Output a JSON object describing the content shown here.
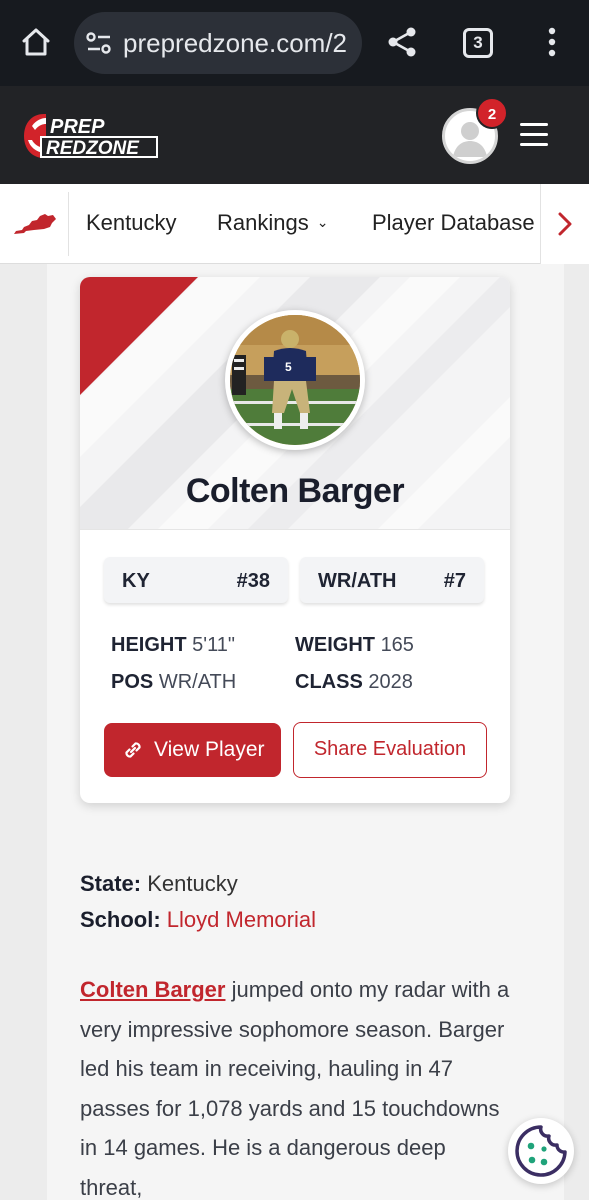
{
  "browser": {
    "url": "prepredzone.com/2",
    "tab_count": "3",
    "icons": [
      "home-icon",
      "site-settings-icon",
      "share-icon",
      "tabs-icon",
      "more-vert-icon"
    ]
  },
  "header": {
    "logo_line1": "PREP",
    "logo_line2": "REDZONE",
    "notification_count": "2",
    "icons": [
      "user-avatar-icon",
      "hamburger-menu-icon"
    ]
  },
  "nav": {
    "items": [
      {
        "label": "Kentucky"
      },
      {
        "label": "Rankings"
      },
      {
        "label": "Player Database"
      }
    ],
    "icons": [
      "kentucky-state-icon",
      "chevron-down-icon",
      "chevron-right-icon"
    ]
  },
  "player": {
    "name": "Colten Barger",
    "state_abbr": "KY",
    "state_rank": "#38",
    "position_group": "WR/ATH",
    "position_rank": "#7",
    "height_label": "HEIGHT",
    "height": "5'11\"",
    "weight_label": "WEIGHT",
    "weight": "165",
    "pos_label": "POS",
    "pos": "WR/ATH",
    "class_label": "CLASS",
    "class": "2028",
    "view_button": "View Player",
    "share_button": "Share Evaluation"
  },
  "details": {
    "state_label": "State:",
    "state": "Kentucky",
    "school_label": "School:",
    "school": "Lloyd Memorial"
  },
  "article": {
    "player_link": "Colten Barger",
    "text": " jumped onto my radar with a very impressive sophomore season. Barger led his team in receiving, hauling in 47 passes for 1,078 yards and 15 touchdowns in 14 games. He is a dangerous deep threat,"
  },
  "colors": {
    "brand_red": "#c1262d",
    "header_dark": "#222326",
    "chrome_dark": "#171a1f"
  }
}
